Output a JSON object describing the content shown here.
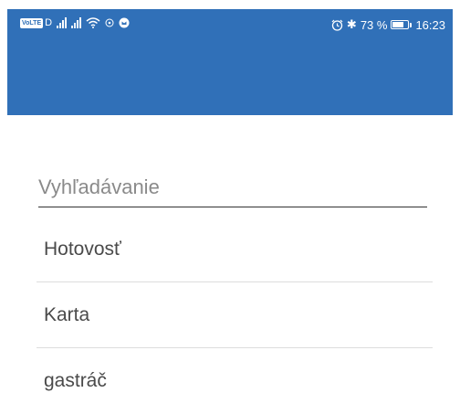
{
  "status_bar": {
    "network_badge": "VoLTE",
    "network_suffix": "D",
    "bluetooth_symbol": "✱",
    "battery_text": "73 %",
    "battery_level": 0.73,
    "time": "16:23",
    "icons": [
      "volte-icon",
      "signal-icon",
      "signal-icon",
      "wifi-icon",
      "data-icon",
      "notification-icon",
      "alarm-icon",
      "bluetooth-icon",
      "battery-icon"
    ]
  },
  "app_bar": {
    "color": "#3070b8"
  },
  "search": {
    "placeholder": "Vyhľadávanie",
    "value": ""
  },
  "list": {
    "items": [
      {
        "label": "Hotovosť"
      },
      {
        "label": "Karta"
      },
      {
        "label": "gastráč"
      }
    ]
  }
}
